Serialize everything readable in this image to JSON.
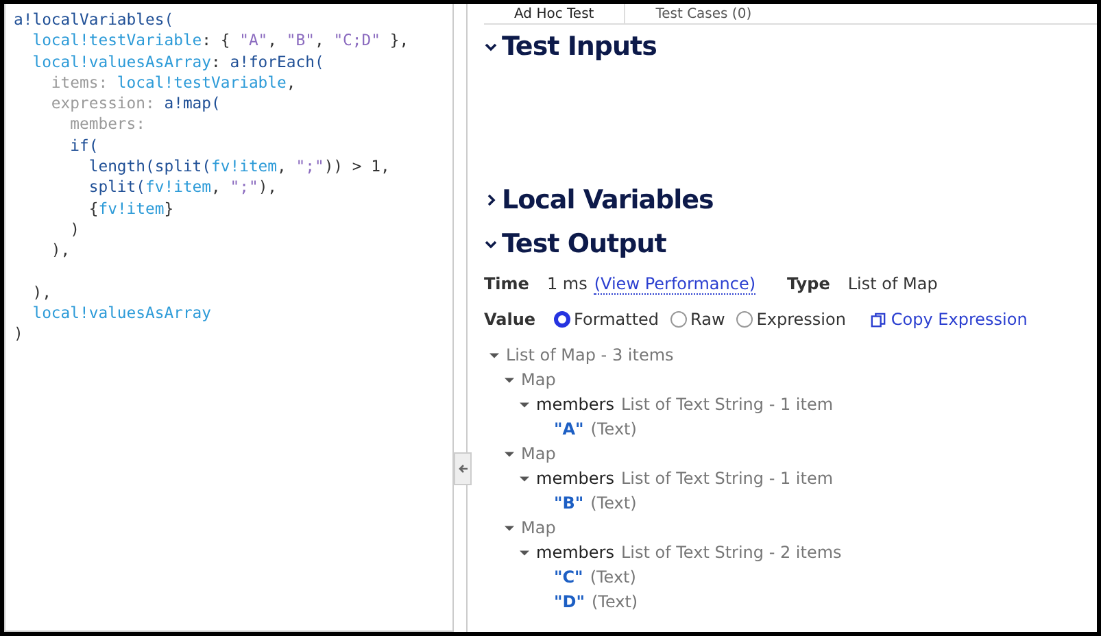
{
  "editor": {
    "lines": [
      {
        "kind": "code",
        "tokens": [
          {
            "text": "a!localVariables(",
            "kind": "fn"
          }
        ]
      },
      {
        "kind": "code",
        "tokens": [
          {
            "text": "  local!testVariable",
            "kind": "var"
          },
          {
            "text": ": { ",
            "kind": "punct"
          },
          {
            "text": "\"A\"",
            "kind": "str"
          },
          {
            "text": ", ",
            "kind": "punct"
          },
          {
            "text": "\"B\"",
            "kind": "str"
          },
          {
            "text": ", ",
            "kind": "punct"
          },
          {
            "text": "\"C;D\"",
            "kind": "str"
          },
          {
            "text": " },",
            "kind": "punct"
          }
        ]
      },
      {
        "kind": "code",
        "tokens": [
          {
            "text": "  local!valuesAsArray",
            "kind": "var"
          },
          {
            "text": ": ",
            "kind": "punct"
          },
          {
            "text": "a!forEach(",
            "kind": "fn"
          }
        ]
      },
      {
        "kind": "code",
        "tokens": [
          {
            "text": "    items:",
            "kind": "key"
          },
          {
            "text": " local!testVariable",
            "kind": "var"
          },
          {
            "text": ",",
            "kind": "punct"
          }
        ]
      },
      {
        "kind": "code",
        "tokens": [
          {
            "text": "    expression:",
            "kind": "key"
          },
          {
            "text": " a!map(",
            "kind": "fn"
          }
        ]
      },
      {
        "kind": "code",
        "tokens": [
          {
            "text": "      members:",
            "kind": "key"
          }
        ]
      },
      {
        "kind": "code",
        "tokens": [
          {
            "text": "      if(",
            "kind": "fn"
          }
        ]
      },
      {
        "kind": "code",
        "tokens": [
          {
            "text": "        length(split(",
            "kind": "fn"
          },
          {
            "text": "fv!item",
            "kind": "var"
          },
          {
            "text": ", ",
            "kind": "punct"
          },
          {
            "text": "\";\"",
            "kind": "str"
          },
          {
            "text": ")) > 1,",
            "kind": "punct"
          }
        ]
      },
      {
        "kind": "code",
        "tokens": [
          {
            "text": "        split(",
            "kind": "fn"
          },
          {
            "text": "fv!item",
            "kind": "var"
          },
          {
            "text": ", ",
            "kind": "punct"
          },
          {
            "text": "\";\"",
            "kind": "str"
          },
          {
            "text": "),",
            "kind": "punct"
          }
        ]
      },
      {
        "kind": "code",
        "tokens": [
          {
            "text": "        {",
            "kind": "punct"
          },
          {
            "text": "fv!item",
            "kind": "var"
          },
          {
            "text": "}",
            "kind": "punct"
          }
        ]
      },
      {
        "kind": "code",
        "tokens": [
          {
            "text": "      )",
            "kind": "punct"
          }
        ]
      },
      {
        "kind": "code",
        "tokens": [
          {
            "text": "    ),",
            "kind": "punct"
          }
        ]
      },
      {
        "kind": "blank"
      },
      {
        "kind": "code",
        "tokens": [
          {
            "text": "  ),",
            "kind": "punct"
          }
        ]
      },
      {
        "kind": "code",
        "tokens": [
          {
            "text": "  local!valuesAsArray",
            "kind": "var"
          }
        ]
      },
      {
        "kind": "code",
        "tokens": [
          {
            "text": ")",
            "kind": "punct"
          }
        ]
      }
    ]
  },
  "tabs": [
    {
      "label": "Ad Hoc Test",
      "selected": true
    },
    {
      "label": "Test Cases (0)",
      "selected": false
    }
  ],
  "sections": [
    {
      "title": "Test Inputs",
      "expanded": true
    },
    {
      "title": "Local Variables",
      "expanded": false
    },
    {
      "title": "Test Output",
      "expanded": true
    }
  ],
  "output": {
    "time_label": "Time",
    "time_value": "1 ms",
    "performance_link": "(View Performance)",
    "type_label": "Type",
    "type_value": "List of Map",
    "value_label": "Value",
    "formats": [
      {
        "label": "Formatted",
        "selected": true
      },
      {
        "label": "Raw",
        "selected": false
      },
      {
        "label": "Expression",
        "selected": false
      }
    ],
    "copy_link": "Copy Expression",
    "tree": [
      {
        "kind": "group",
        "label": "List of Map - 3 items",
        "expanded": true,
        "children": [
          {
            "kind": "group",
            "label": "Map",
            "expanded": true,
            "children": [
              {
                "kind": "field",
                "label": "members",
                "type": "List of Text String - 1 item",
                "expanded": true,
                "children": [
                  {
                    "kind": "value",
                    "label": "\"A\"",
                    "type": "(Text)"
                  }
                ]
              }
            ]
          },
          {
            "kind": "group",
            "label": "Map",
            "expanded": true,
            "children": [
              {
                "kind": "field",
                "label": "members",
                "type": "List of Text String - 1 item",
                "expanded": true,
                "children": [
                  {
                    "kind": "value",
                    "label": "\"B\"",
                    "type": "(Text)"
                  }
                ]
              }
            ]
          },
          {
            "kind": "group",
            "label": "Map",
            "expanded": true,
            "children": [
              {
                "kind": "field",
                "label": "members",
                "type": "List of Text String - 2 items",
                "expanded": true,
                "children": [
                  {
                    "kind": "value",
                    "label": "\"C\"",
                    "type": "(Text)"
                  },
                  {
                    "kind": "value",
                    "label": "\"D\"",
                    "type": "(Text)"
                  }
                ]
              }
            ]
          }
        ]
      }
    ]
  }
}
